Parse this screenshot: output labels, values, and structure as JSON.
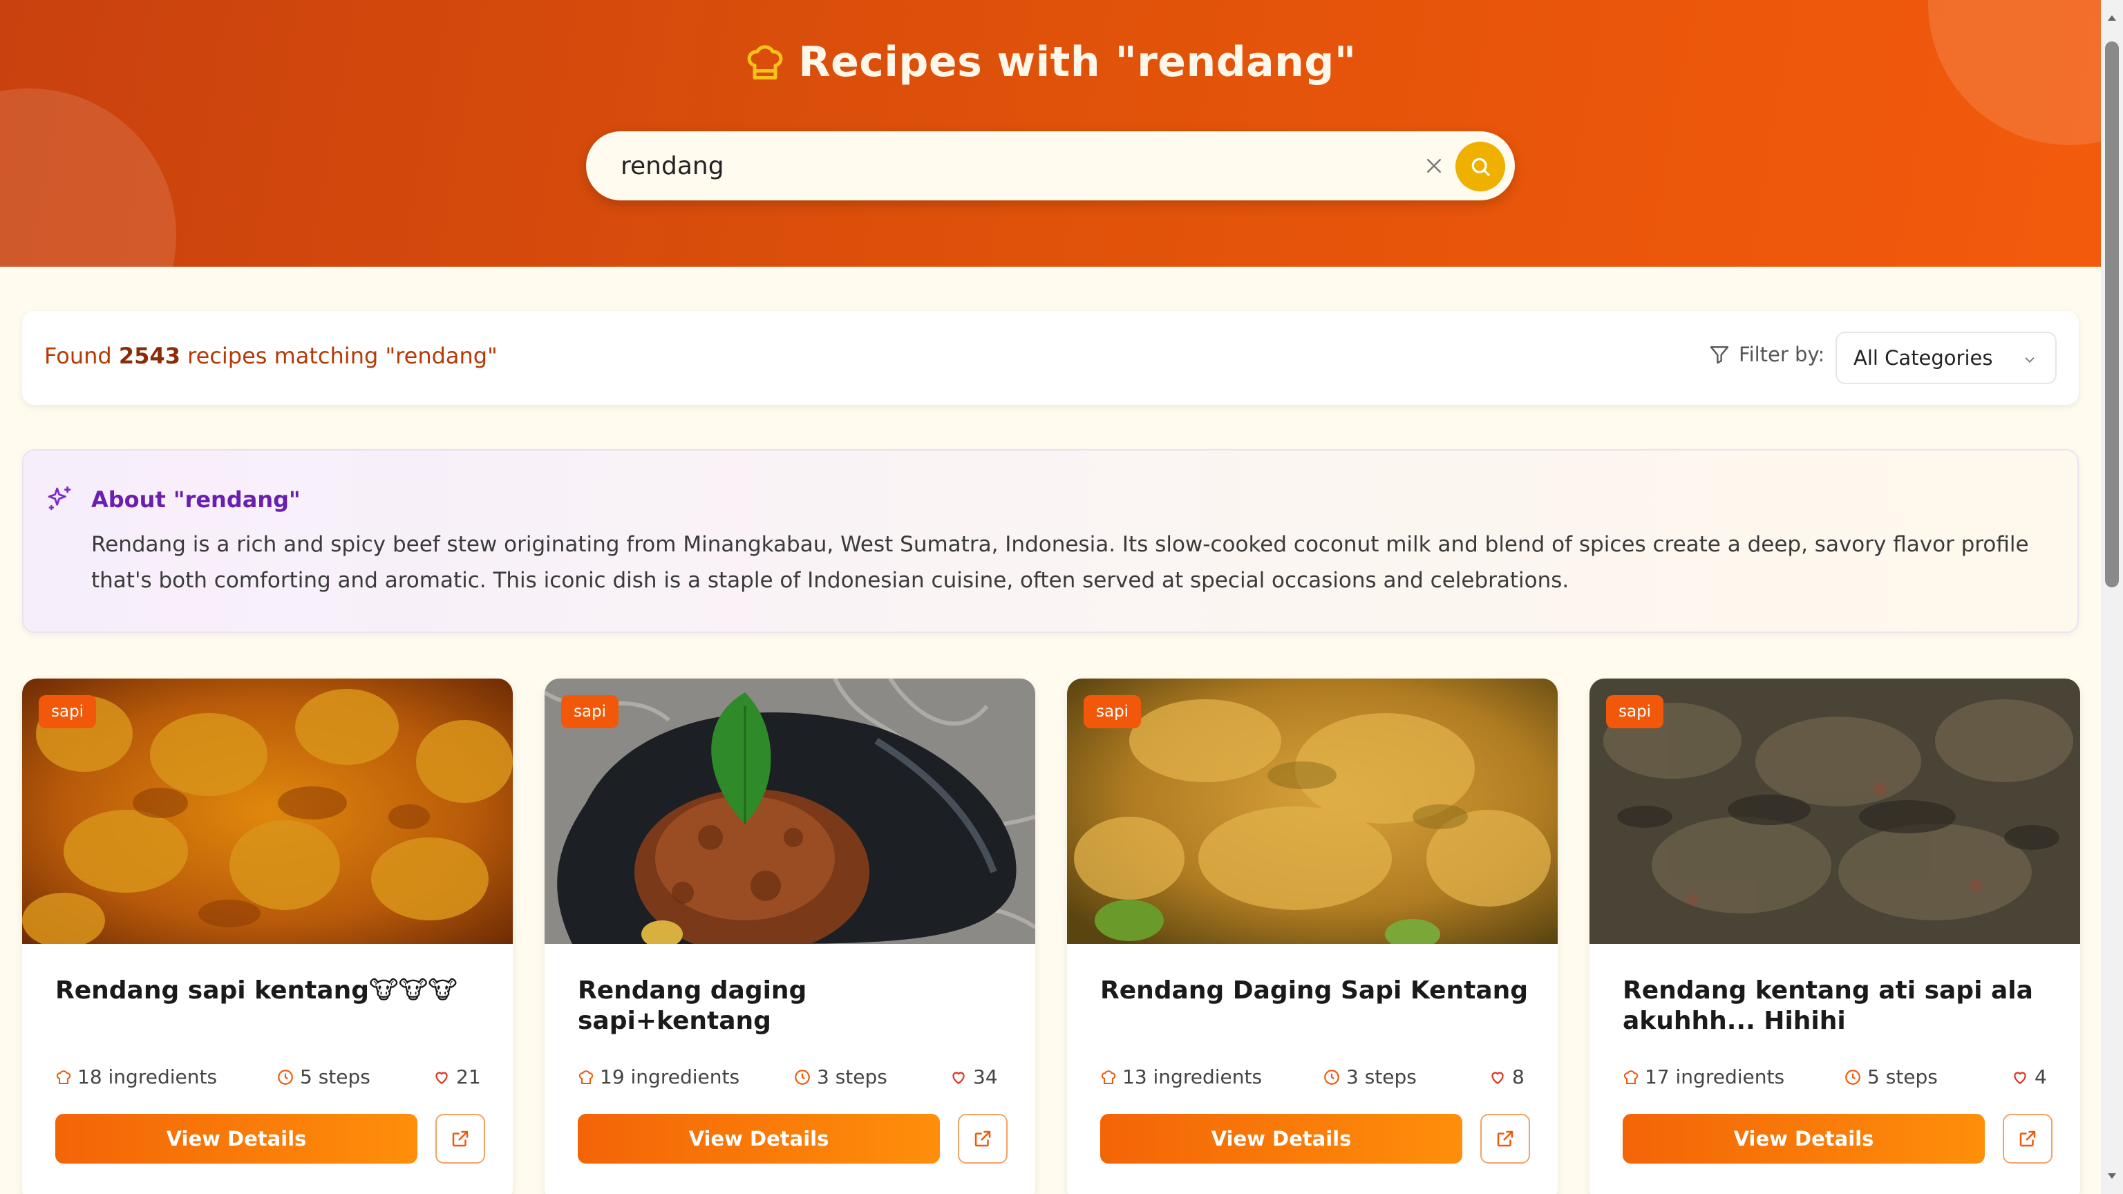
{
  "header": {
    "title": "Recipes with \"rendang\"",
    "chef_icon": "chef-hat-icon",
    "search": {
      "value": "rendang",
      "placeholder": "Search recipes..."
    },
    "clear_icon": "close-icon",
    "search_icon": "search-icon"
  },
  "results": {
    "prefix": "Found ",
    "count": "2543",
    "suffix": " recipes matching \"rendang\"",
    "filter_label": "Filter by:",
    "filter_value": "All Categories"
  },
  "about": {
    "title": "About \"rendang\"",
    "text": "Rendang is a rich and spicy beef stew originating from Minangkabau, West Sumatra, Indonesia. Its slow-cooked coconut milk and blend of spices create a deep, savory flavor profile that's both comforting and aromatic. This iconic dish is a staple of Indonesian cuisine, often served at special occasions and celebrations."
  },
  "cards": [
    {
      "badge": "sapi",
      "title": "Rendang sapi kentang🐮🐮🐮",
      "ingredients": "18 ingredients",
      "steps": "5 steps",
      "likes": "21",
      "button": "View Details"
    },
    {
      "badge": "sapi",
      "title": "Rendang daging sapi+kentang",
      "ingredients": "19 ingredients",
      "steps": "3 steps",
      "likes": "34",
      "button": "View Details"
    },
    {
      "badge": "sapi",
      "title": "Rendang Daging Sapi Kentang",
      "ingredients": "13 ingredients",
      "steps": "3 steps",
      "likes": "8",
      "button": "View Details"
    },
    {
      "badge": "sapi",
      "title": "Rendang kentang ati sapi ala akuhhh... Hihihi",
      "ingredients": "17 ingredients",
      "steps": "5 steps",
      "likes": "4",
      "button": "View Details"
    }
  ],
  "colors": {
    "header_orange": "#e0520a",
    "accent_yellow": "#f0b000",
    "button_orange": "#f36407",
    "about_purple": "#6a1fb0"
  }
}
